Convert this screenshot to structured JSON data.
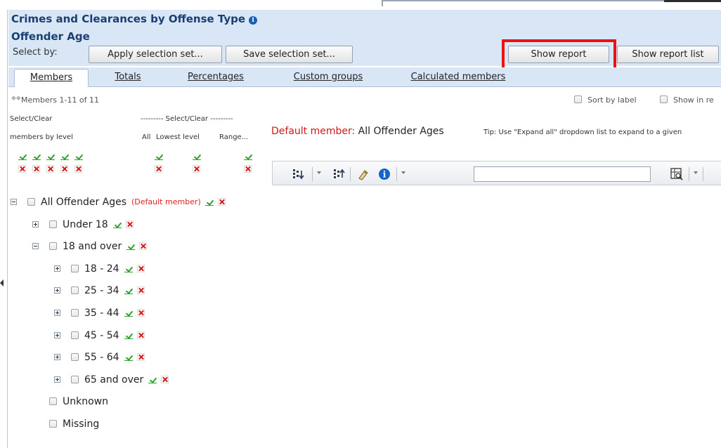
{
  "report": {
    "title": "Crimes and Clearances by Offense Type",
    "info_icon": "info-icon",
    "dimension": "Offender Age",
    "select_by_label": "Select by:",
    "buttons": {
      "apply": "Apply selection set...",
      "save": "Save selection set...",
      "show_report": "Show report",
      "show_report_list": "Show report list"
    }
  },
  "tabs": [
    {
      "label": "Members",
      "active": true
    },
    {
      "label": "Totals",
      "active": false
    },
    {
      "label": "Percentages",
      "active": false
    },
    {
      "label": "Custom groups",
      "active": false
    },
    {
      "label": "Calculated members",
      "active": false
    }
  ],
  "nav": {
    "member_count": "Members 1-11 of 11",
    "sort_by_label": "Sort by label",
    "show_in_report": "Show in re"
  },
  "selection": {
    "select_clear": "Select/Clear",
    "members_by_level": "members by level",
    "dashed_header": "--------- Select/Clear ---------",
    "all": "All",
    "lowest_level": "Lowest level",
    "range": "Range..."
  },
  "default_member": {
    "label": "Default member:",
    "value": "All Offender Ages"
  },
  "tip": "Tip: Use \"Expand all\" dropdown list to expand to a given",
  "toolbar": {
    "icons": [
      "expand-all-icon",
      "collapse-all-icon",
      "tag-icon",
      "info-icon",
      "search-icon"
    ],
    "search_value": ""
  },
  "tree": [
    {
      "label": "All Offender Ages",
      "note": "(Default member)",
      "expander": "minus",
      "indent": 0
    },
    {
      "label": "Under 18",
      "note": "",
      "expander": "plus",
      "indent": 1
    },
    {
      "label": "18 and over",
      "note": "",
      "expander": "minus",
      "indent": 1
    },
    {
      "label": "18 - 24",
      "note": "",
      "expander": "plus",
      "indent": 2
    },
    {
      "label": "25 - 34",
      "note": "",
      "expander": "plus",
      "indent": 2
    },
    {
      "label": "35 - 44",
      "note": "",
      "expander": "plus",
      "indent": 2
    },
    {
      "label": "45 - 54",
      "note": "",
      "expander": "plus",
      "indent": 2
    },
    {
      "label": "55 - 64",
      "note": "",
      "expander": "plus",
      "indent": 2
    },
    {
      "label": "65 and over",
      "note": "",
      "expander": "plus",
      "indent": 2
    },
    {
      "label": "Unknown",
      "note": "",
      "expander": "none",
      "indent": 1
    },
    {
      "label": "Missing",
      "note": "",
      "expander": "none",
      "indent": 1
    }
  ],
  "colors": {
    "title": "#1b3f73",
    "header_bg": "#d9e6f5",
    "highlight": "#ee1111",
    "check": "#2aa12a",
    "cross": "#d11a1a"
  }
}
